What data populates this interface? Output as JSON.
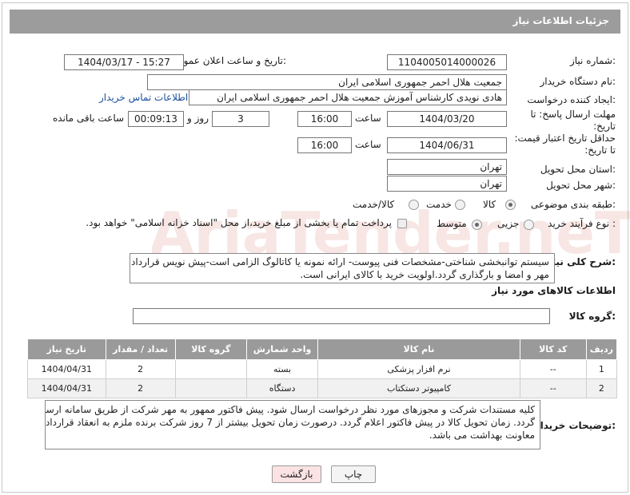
{
  "header": {
    "title": "جزئیات اطلاعات نیاز"
  },
  "form": {
    "need_number": {
      "label": "شماره نیاز:",
      "value": "1104005014000026"
    },
    "announce_datetime": {
      "label": "تاریخ و ساعت اعلان عمومی:",
      "value": "1404/03/17 - 15:27"
    },
    "buyer_org": {
      "label": "نام دستگاه خریدار:",
      "value": "جمعیت هلال احمر جمهوری اسلامی ایران"
    },
    "requester": {
      "label": "ایجاد کننده درخواست:",
      "value": "هادی نویدی کارشناس آموزش جمعیت هلال احمر جمهوری اسلامی ایران",
      "contact_link": "اطلاعات تماس خریدار"
    },
    "reply_deadline": {
      "label_line1": "مهلت ارسال پاسخ: تا",
      "label_line2": "تاریخ:",
      "date": "1404/03/20",
      "time_label": "ساعت",
      "time": "16:00",
      "days": "3",
      "days_label": "روز و",
      "remaining": "00:09:13",
      "remaining_label": "ساعت باقی مانده"
    },
    "price_validity": {
      "label_line1": "حداقل تاریخ اعتبار قیمت:",
      "label_line2": "تا تاریخ:",
      "date": "1404/06/31",
      "time_label": "ساعت",
      "time": "16:00"
    },
    "delivery_province": {
      "label": "استان محل تحویل:",
      "value": "تهران"
    },
    "delivery_city": {
      "label": "شهر محل تحویل:",
      "value": "تهران"
    },
    "category": {
      "label": "طبقه بندی موضوعی:",
      "options": [
        "کالا",
        "خدمت",
        "کالا/خدمت"
      ],
      "selected": "کالا"
    },
    "purchase_process": {
      "label": "نوع فرآیند خرید :",
      "options": [
        "جزیی",
        "متوسط"
      ],
      "selected": "متوسط",
      "note": "پرداخت تمام یا بخشی از مبلغ خرید،از محل \"اسناد خزانه اسلامی\" خواهد بود."
    }
  },
  "description": {
    "label": "شرح کلی نیاز:",
    "line1": "سیستم توانبخشی شناختی-مشخصات فنی پیوست- ارائه نمونه یا کاتالوگ الزامی است-پیش نویس قرارداد",
    "line2": "مهر و امضا و بارگذاری گردد.اولویت خرید با کالای ایرانی است."
  },
  "goods_section": {
    "title": "اطلاعات کالاهای مورد نیاز",
    "group_label": "گروه کالا:",
    "group_value": ""
  },
  "table": {
    "headers": [
      "ردیف",
      "کد کالا",
      "نام کالا",
      "واحد شمارش",
      "گروه کالا",
      "تعداد / مقدار",
      "تاریخ نیاز"
    ],
    "rows": [
      [
        "1",
        "--",
        "نرم افزار پزشکی",
        "بسته",
        "",
        "2",
        "1404/04/31"
      ],
      [
        "2",
        "--",
        "کامپیوتر دستکتاب",
        "دستگاه",
        "",
        "2",
        "1404/04/31"
      ]
    ]
  },
  "buyer_notes": {
    "label": "توضیحات خریدار:",
    "line1": "کلیه مستندات شرکت و مجوزهای مورد نظر درخواست ارسال شود. پیش فاکتور ممهور به مهر شرکت از طریق سامانه ارسال",
    "line2": "گردد. زمان تحویل کالا در پیش فاکتور اعلام گردد. درصورت زمان تحویل بیشتر از 7 روز شرکت برنده ملزم به انعقاد قرارداد با",
    "line3": "معاونت بهداشت می باشد."
  },
  "buttons": {
    "print": "چاپ",
    "back": "بازگشت"
  },
  "watermark": {
    "text": "AriaTender.neT"
  },
  "colors": {
    "titlebar": "#9c9c9c",
    "table_header": "#9a9a9a",
    "link": "#1b4f9c",
    "back_button": "#fbe3e3"
  }
}
